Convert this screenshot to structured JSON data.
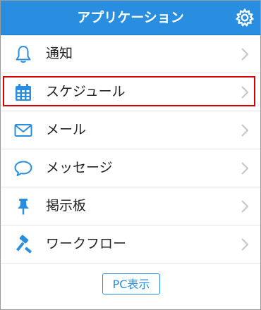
{
  "header": {
    "title": "アプリケーション",
    "settings_icon": "gear-icon"
  },
  "colors": {
    "header_bg": "#2a8ee0",
    "icon_blue": "#2a8ee0",
    "selection_border": "#d40000",
    "chevron": "#c8c8c8"
  },
  "menu": {
    "items": [
      {
        "label": "通知",
        "icon": "bell-icon"
      },
      {
        "label": "スケジュール",
        "icon": "calendar-icon",
        "selected": true
      },
      {
        "label": "メール",
        "icon": "mail-icon"
      },
      {
        "label": "メッセージ",
        "icon": "speech-bubble-icon"
      },
      {
        "label": "掲示板",
        "icon": "pushpin-icon"
      },
      {
        "label": "ワークフロー",
        "icon": "gavel-icon"
      }
    ]
  },
  "footer": {
    "pc_view_label": "PC表示"
  }
}
